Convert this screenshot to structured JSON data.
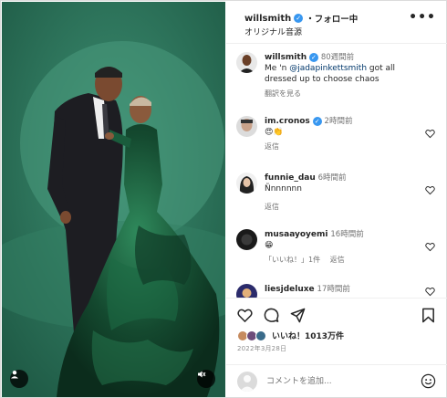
{
  "header": {
    "username": "willsmith",
    "follow_status": "・フォロー中",
    "audio": "オリジナル音源",
    "more_label": "•••"
  },
  "caption": {
    "username": "willsmith",
    "time": "80週間前",
    "text_prefix": "Me 'n ",
    "mention": "@jadapinkettsmith",
    "text_suffix": " got all dressed up to choose chaos",
    "translate": "翻訳を見る"
  },
  "comments": [
    {
      "username": "im.cronos",
      "verified": true,
      "time": "2時間前",
      "text": "😍👏",
      "reply": "返信",
      "likes": ""
    },
    {
      "username": "funnie_dau",
      "verified": false,
      "time": "6時間前",
      "text": "Ñnnnnnn",
      "reply": "返信",
      "likes": ""
    },
    {
      "username": "musaayoyemi",
      "verified": false,
      "time": "16時間前",
      "text": "😁",
      "reply": "返信",
      "likes": "「いいね！」1件"
    },
    {
      "username": "liesjdeluxe",
      "verified": false,
      "time": "17時間前",
      "text": "",
      "reply": "",
      "likes": ""
    }
  ],
  "likes": {
    "text": "いいね！1013万件"
  },
  "date": "2022年3月28日",
  "add_comment": {
    "placeholder": "コメントを追加..."
  },
  "icons": {
    "more": "more-icon",
    "heart": "heart-icon",
    "comment": "comment-icon",
    "share": "share-icon",
    "bookmark": "bookmark-icon",
    "emoji": "emoji-icon",
    "mute": "mute-icon",
    "tagged_user": "user-icon"
  },
  "colors": {
    "verified": "#3897f0",
    "mention": "#00376b",
    "backdrop": "#2f7a60"
  }
}
